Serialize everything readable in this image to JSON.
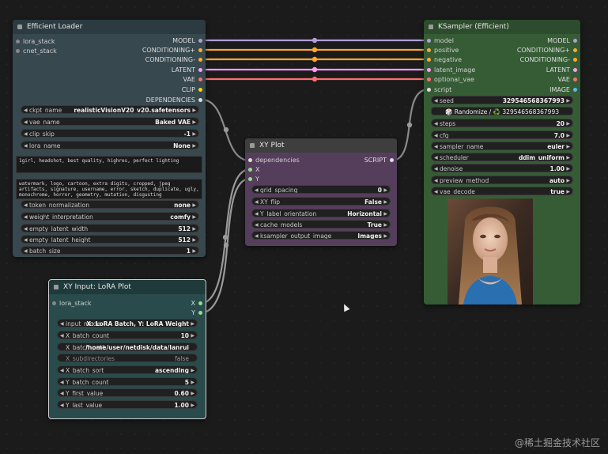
{
  "loader": {
    "title": "Efficient Loader",
    "inputs": [
      "lora_stack",
      "cnet_stack"
    ],
    "outputs": [
      {
        "label": "MODEL",
        "color": "#b39ddb"
      },
      {
        "label": "CONDITIONING+",
        "color": "#ffa931"
      },
      {
        "label": "CONDITIONING-",
        "color": "#ffa931"
      },
      {
        "label": "LATENT",
        "color": "#ff9cf9"
      },
      {
        "label": "VAE",
        "color": "#ff6e6e"
      },
      {
        "label": "CLIP",
        "color": "#ffd500"
      },
      {
        "label": "DEPENDENCIES",
        "color": "#ffffff"
      }
    ],
    "widgets_top": [
      {
        "label": "ckpt_name",
        "value": "realisticVisionV20_v20.safetensors"
      },
      {
        "label": "vae_name",
        "value": "Baked VAE"
      },
      {
        "label": "clip_skip",
        "value": "-1"
      },
      {
        "label": "lora_name",
        "value": "None"
      }
    ],
    "positive_prompt": "1girl, headshot, best quality, highres, perfect lighting",
    "negative_prompt": "watermark, logo, cartoon, extra digits, cropped, jpeg artifacts, signature, username, error, sketch, duplicate, ugly, monochrome, horror, geometry, mutation, disgusting",
    "widgets_bottom": [
      {
        "label": "token_normalization",
        "value": "none"
      },
      {
        "label": "weight_interpretation",
        "value": "comfy"
      },
      {
        "label": "empty_latent_width",
        "value": "512"
      },
      {
        "label": "empty_latent_height",
        "value": "512"
      },
      {
        "label": "batch_size",
        "value": "1"
      }
    ]
  },
  "ksampler": {
    "title": "KSampler (Efficient)",
    "inputs": [
      {
        "label": "model",
        "color": "#b39ddb"
      },
      {
        "label": "positive",
        "color": "#ffa931"
      },
      {
        "label": "negative",
        "color": "#ffa931"
      },
      {
        "label": "latent_image",
        "color": "#ff9cf9"
      },
      {
        "label": "optional_vae",
        "color": "#ff6e6e"
      },
      {
        "label": "script",
        "color": "#ffffff"
      }
    ],
    "outputs": [
      {
        "label": "MODEL",
        "color": "#b39ddb"
      },
      {
        "label": "CONDITIONING+",
        "color": "#ffa931"
      },
      {
        "label": "CONDITIONING-",
        "color": "#ffa931"
      },
      {
        "label": "LATENT",
        "color": "#ff9cf9"
      },
      {
        "label": "VAE",
        "color": "#ff6e6e"
      },
      {
        "label": "IMAGE",
        "color": "#64b5f6"
      }
    ],
    "seed": {
      "label": "seed",
      "value": "329546568367993"
    },
    "randomize_label": "🎲 Randomize / ♻️ 329546568367993",
    "widgets": [
      {
        "label": "steps",
        "value": "20"
      },
      {
        "label": "cfg",
        "value": "7.0"
      },
      {
        "label": "sampler_name",
        "value": "euler"
      },
      {
        "label": "scheduler",
        "value": "ddim_uniform"
      },
      {
        "label": "denoise",
        "value": "1.00"
      },
      {
        "label": "preview_method",
        "value": "auto"
      },
      {
        "label": "vae_decode",
        "value": "true"
      }
    ]
  },
  "xyplot": {
    "title": "XY Plot",
    "inputs": [
      {
        "label": "dependencies",
        "color": "#ffffff"
      },
      {
        "label": "X",
        "color": "#8fe08f"
      },
      {
        "label": "Y",
        "color": "#8fe08f"
      }
    ],
    "output": {
      "label": "SCRIPT",
      "color": "#ffffff"
    },
    "widgets": [
      {
        "label": "grid_spacing",
        "value": "0"
      },
      {
        "label": "XY_flip",
        "value": "False"
      },
      {
        "label": "Y_label_orientation",
        "value": "Horizontal"
      },
      {
        "label": "cache_models",
        "value": "True"
      },
      {
        "label": "ksampler_output_image",
        "value": "Images"
      }
    ]
  },
  "lora": {
    "title": "XY Input: LoRA Plot",
    "inputs": [
      "lora_stack"
    ],
    "outputs": [
      {
        "label": "X",
        "color": "#8fe08f"
      },
      {
        "label": "Y",
        "color": "#8fe08f"
      }
    ],
    "widgets": [
      {
        "label": "input_mode",
        "value": "X: LoRA Batch, Y: LoRA Weight"
      },
      {
        "label": "X_batch_count",
        "value": "10"
      },
      {
        "label": "X_batch_path",
        "value": "/home/user/netdisk/data/lanrui"
      },
      {
        "label": "X_subdirectories",
        "value": "false"
      },
      {
        "label": "X_batch_sort",
        "value": "ascending"
      },
      {
        "label": "Y_batch_count",
        "value": "5"
      },
      {
        "label": "Y_first_value",
        "value": "0.60"
      },
      {
        "label": "Y_last_value",
        "value": "1.00"
      }
    ]
  },
  "watermark": "@稀土掘金技术社区"
}
